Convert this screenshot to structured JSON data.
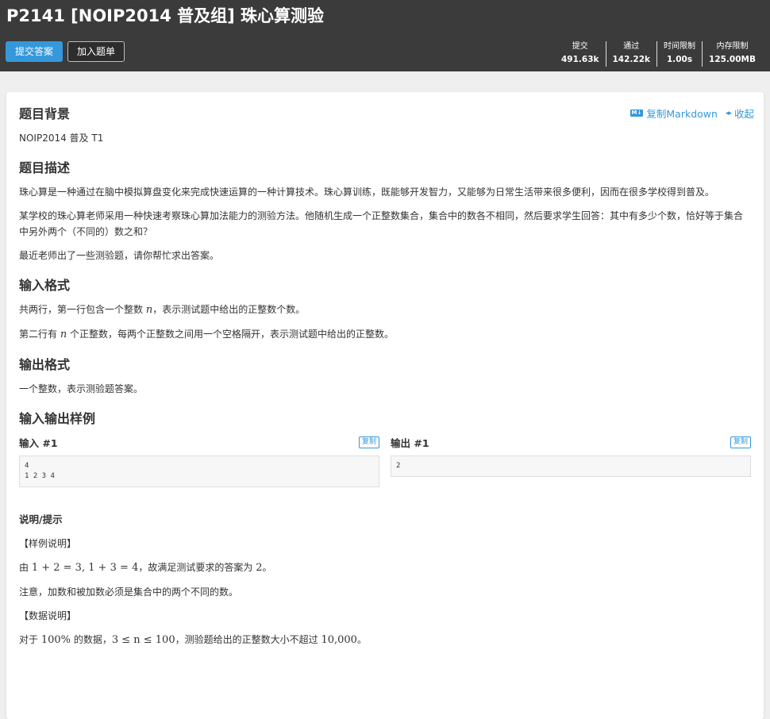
{
  "header": {
    "title": "P2141 [NOIP2014 普及组] 珠心算测验",
    "submit_label": "提交答案",
    "add_list_label": "加入题单",
    "stats": [
      {
        "label": "提交",
        "value": "491.63k"
      },
      {
        "label": "通过",
        "value": "142.22k"
      },
      {
        "label": "时间限制",
        "value": "1.00s"
      },
      {
        "label": "内存限制",
        "value": "125.00MB"
      }
    ]
  },
  "tools": {
    "md_badge": "M↓",
    "copy_markdown": "复制Markdown",
    "collapse": "收起"
  },
  "background": {
    "title": "题目背景",
    "text": "NOIP2014 普及 T1"
  },
  "description": {
    "title": "题目描述",
    "p1": "珠心算是一种通过在脑中模拟算盘变化来完成快速运算的一种计算技术。珠心算训练，既能够开发智力，又能够为日常生活带来很多便利，因而在很多学校得到普及。",
    "p2": "某学校的珠心算老师采用一种快速考察珠心算加法能力的测验方法。他随机生成一个正整数集合，集合中的数各不相同，然后要求学生回答：其中有多少个数，恰好等于集合中另外两个（不同的）数之和？",
    "p3": "最近老师出了一些测验题，请你帮忙求出答案。"
  },
  "input_format": {
    "title": "输入格式",
    "l1_a": "共两行，第一行包含一个整数 ",
    "l1_var": "n",
    "l1_b": "，表示测试题中给出的正整数个数。",
    "l2_a": "第二行有 ",
    "l2_var": "n",
    "l2_b": " 个正整数，每两个正整数之间用一个空格隔开，表示测试题中给出的正整数。"
  },
  "output_format": {
    "title": "输出格式",
    "text": "一个整数，表示测验题答案。"
  },
  "samples": {
    "title": "输入输出样例",
    "copy_label": "复制",
    "input_title": "输入 #1",
    "input_content": "4\n1 2 3 4",
    "output_title": "输出 #1",
    "output_content": "2"
  },
  "hint": {
    "title": "说明/提示",
    "sample_note": "【样例说明】",
    "example_a": "由 ",
    "example_math": "1 + 2 = 3, 1 + 3 = 4",
    "example_b": "，故满足测试要求的答案为 ",
    "example_ans": "2",
    "example_c": "。",
    "caution": "注意，加数和被加数必须是集合中的两个不同的数。",
    "data_note": "【数据说明】",
    "range_a": "对于 ",
    "range_pct": "100%",
    "range_b": " 的数据，",
    "range_math": "3 ≤ n ≤ 100",
    "range_c": "，测验题给出的正整数大小不超过 ",
    "range_max": "10,000",
    "range_d": "。"
  }
}
